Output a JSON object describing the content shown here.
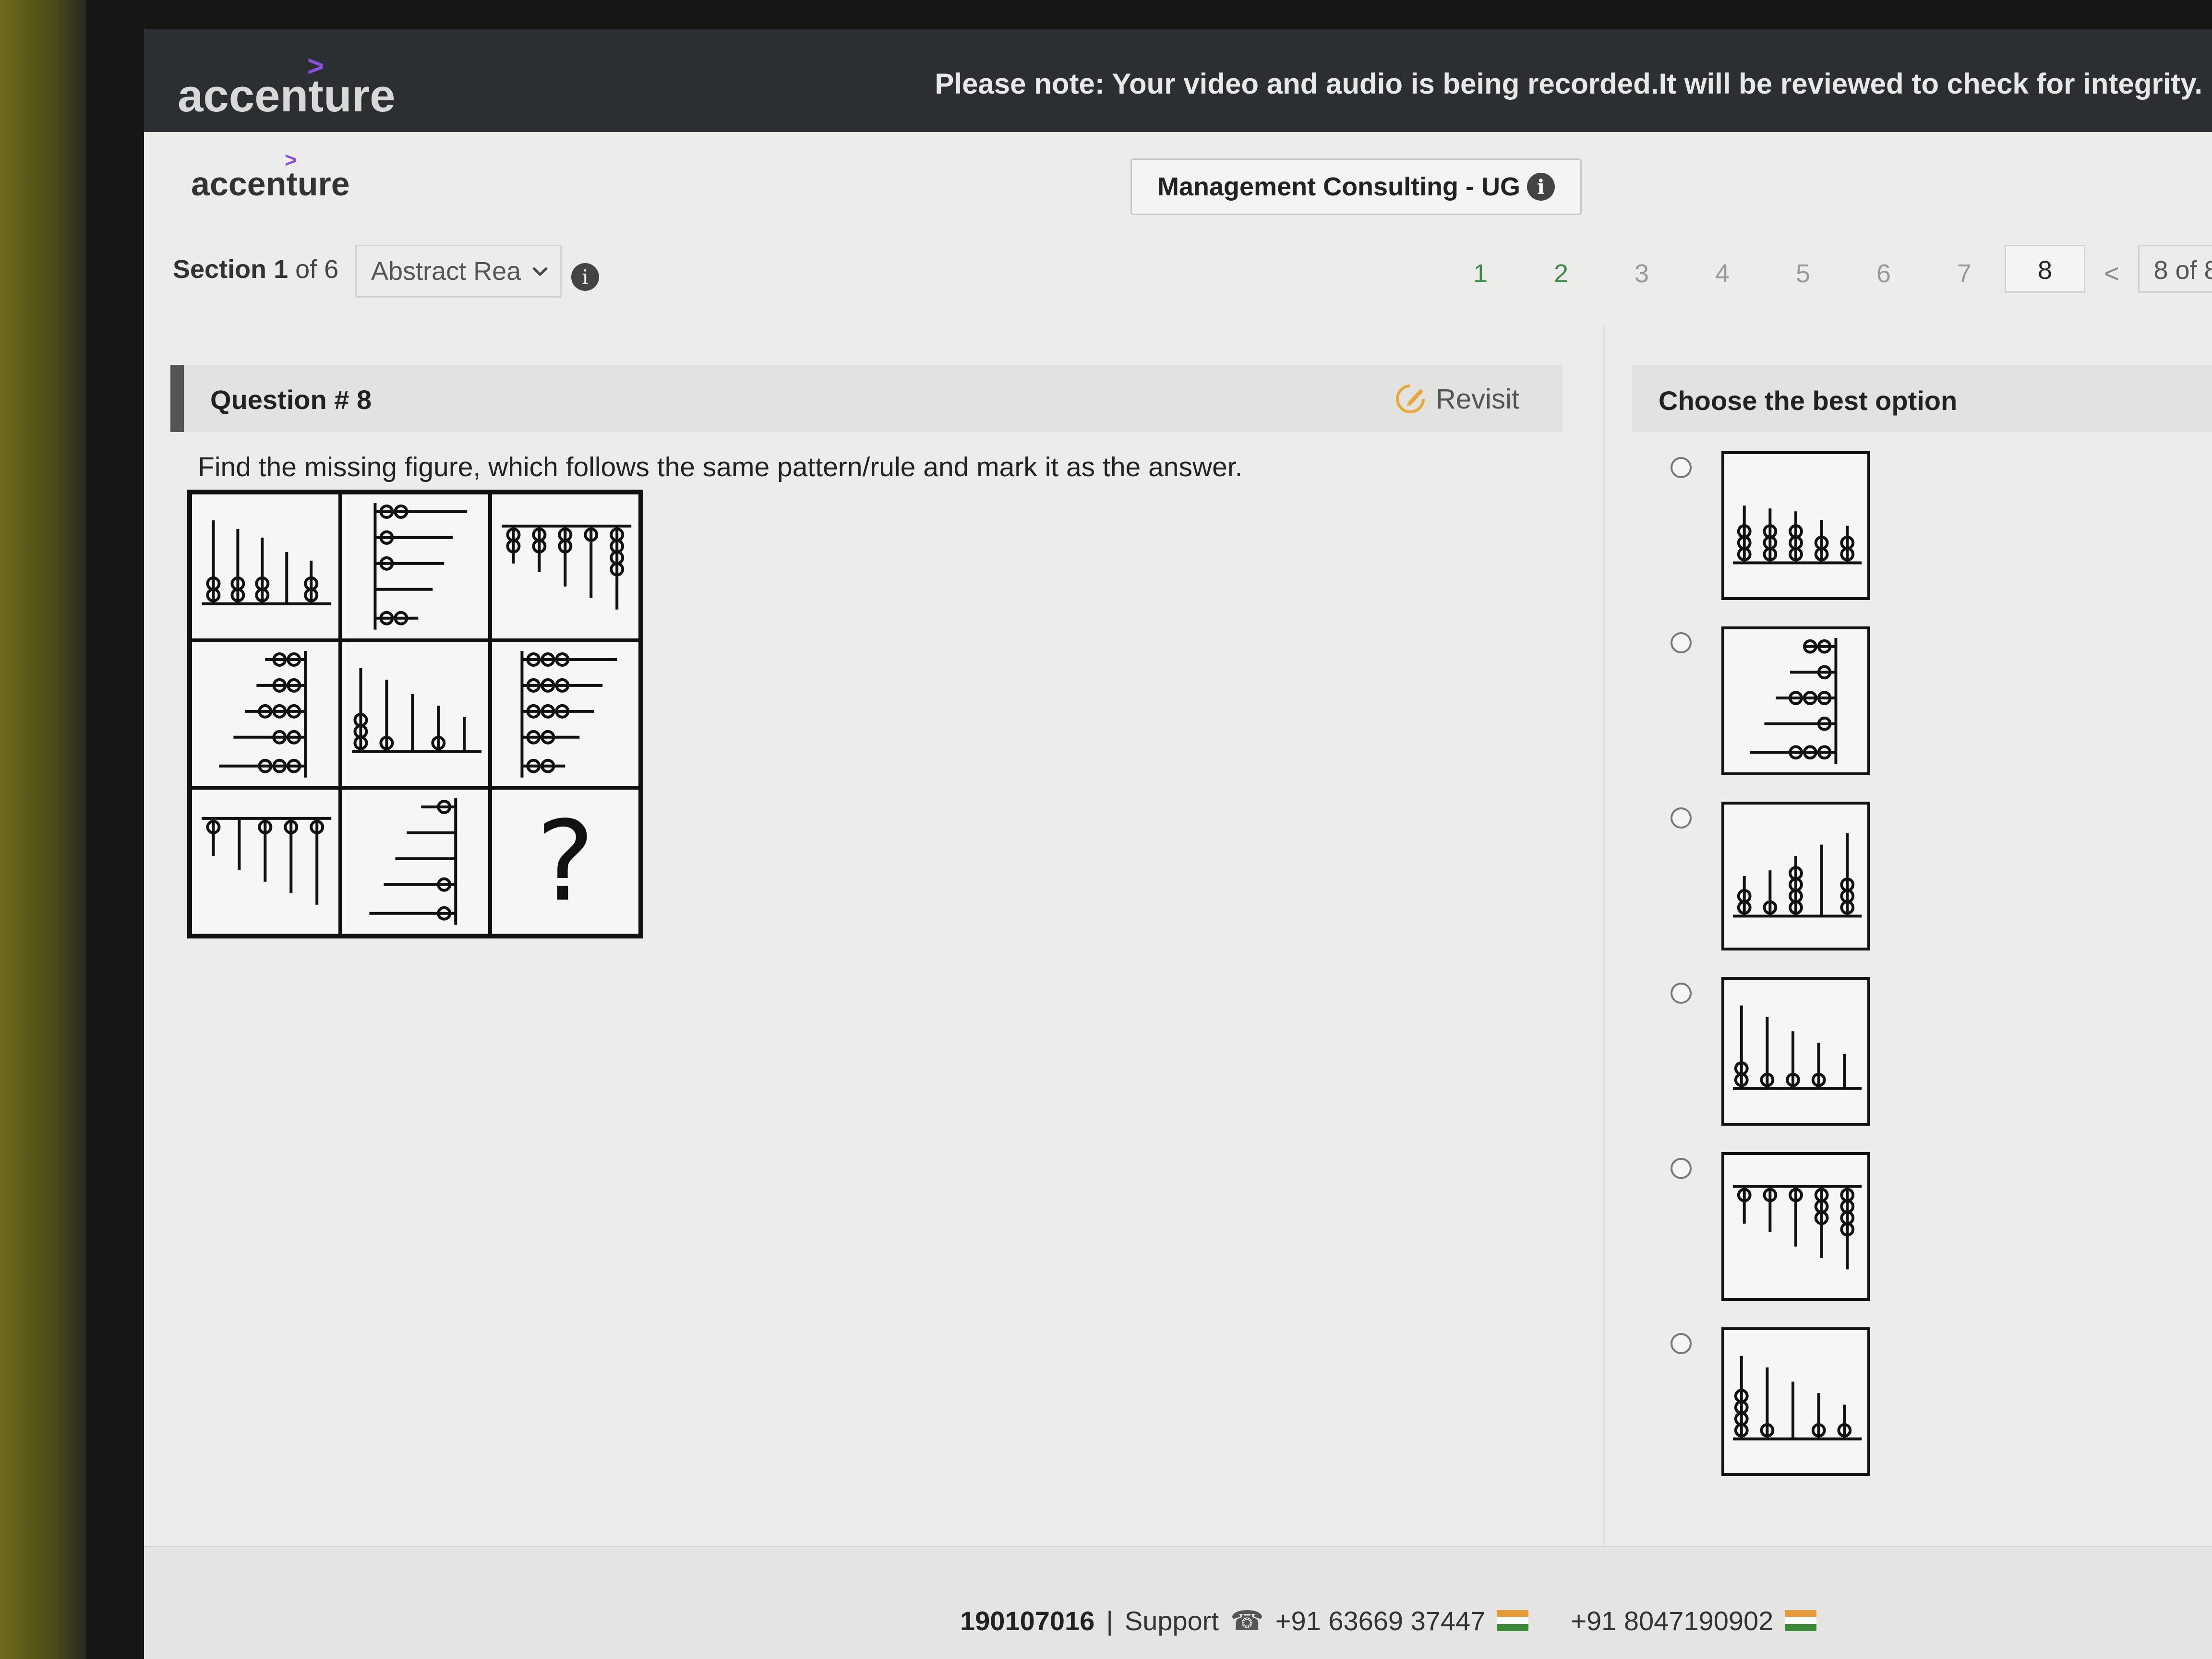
{
  "topbar": {
    "logo": "accenture",
    "notice": "Please note: Your video and audio is being recorded.It will be reviewed to check for integrity."
  },
  "header": {
    "logo": "accenture",
    "course": "Management Consulting - UG"
  },
  "section": {
    "label": "Section",
    "number": "1",
    "of_total": "of 6",
    "selected": "Abstract Rea"
  },
  "pager": {
    "pages": [
      "1",
      "2",
      "3",
      "4",
      "5",
      "6",
      "7",
      "8"
    ],
    "current": "8",
    "prev_label": "<",
    "position": "8 of 8"
  },
  "question": {
    "title": "Question # 8",
    "revisit": "Revisit",
    "text": "Find the missing figure, which follows the same pattern/rule and mark it as the answer.",
    "missing_mark": "?"
  },
  "options_panel": {
    "title": "Choose the best option",
    "count": 6
  },
  "footer": {
    "id": "190107016",
    "separator": "|",
    "support": "Support",
    "phone1": "+91 63669 37447",
    "phone2": "+91 8047190902"
  }
}
